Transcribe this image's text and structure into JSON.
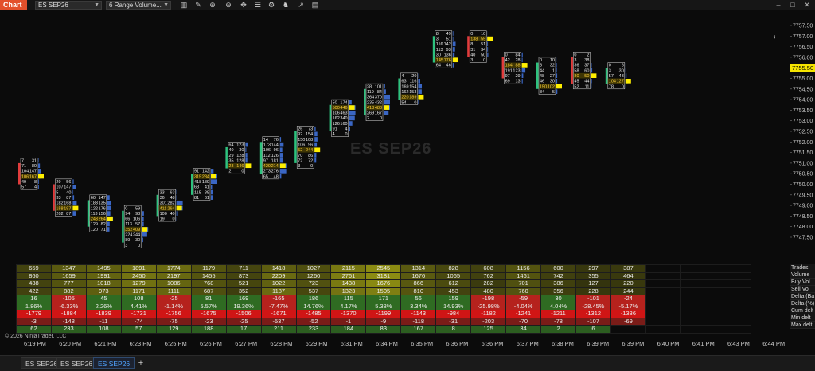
{
  "toolbar": {
    "badge": "Chart",
    "instrument": "ES SEP26",
    "bar_type": "6 Range Volume...",
    "icons": [
      "bar-style-icon",
      "draw-tool-icon",
      "zoom-in-icon",
      "zoom-out-icon",
      "crosshair-icon",
      "hand-icon",
      "properties-icon",
      "strategy-icon",
      "indicator-icon",
      "data-box-icon"
    ]
  },
  "watermark": "ES SEP26",
  "copyright": "© 2026 NinjaTrader, LLC",
  "price_axis": {
    "ticks": [
      "7757.50",
      "7757.00",
      "7756.50",
      "7756.00",
      "7755.50",
      "7755.00",
      "7754.50",
      "7754.00",
      "7753.50",
      "7753.00",
      "7752.50",
      "7752.00",
      "7751.50",
      "7751.00",
      "7750.50",
      "7750.00",
      "7749.50",
      "7749.00",
      "7748.50",
      "7748.00",
      "7747.50"
    ],
    "current_price": "7755.50"
  },
  "chart_data": {
    "type": "footprint",
    "price_min": 7747.5,
    "price_max": 7757.5,
    "bars": [
      {
        "start": 7751.25,
        "rows": [
          [
            "7",
            "31"
          ],
          [
            "71",
            "80"
          ],
          [
            "104",
            "147"
          ],
          [
            "106",
            "167"
          ],
          [
            "49",
            "8"
          ],
          [
            "57",
            "4"
          ]
        ],
        "up": false,
        "poc": 3
      },
      {
        "start": 7750.25,
        "rows": [
          [
            "29",
            "56"
          ],
          [
            "107",
            "147"
          ],
          [
            "5",
            "40"
          ],
          [
            "33",
            "87"
          ],
          [
            "182",
            "168"
          ],
          [
            "158",
            "197"
          ],
          [
            "202",
            "87"
          ]
        ],
        "up": false,
        "poc": 5
      },
      {
        "start": 7749.5,
        "rows": [
          [
            "60",
            "147"
          ],
          [
            "183",
            "135"
          ],
          [
            "122",
            "176"
          ],
          [
            "113",
            "156"
          ],
          [
            "243",
            "264"
          ],
          [
            "129",
            "82"
          ],
          [
            "120",
            "71"
          ]
        ],
        "up": true,
        "poc": 4
      },
      {
        "start": 7749.0,
        "rows": [
          [
            "0",
            "59"
          ],
          [
            "94",
            "93"
          ],
          [
            "66",
            "106"
          ],
          [
            "113",
            "57"
          ],
          [
            "352",
            "409"
          ],
          [
            "224",
            "244"
          ],
          [
            "89",
            "30"
          ],
          [
            "3",
            "0"
          ]
        ],
        "up": true,
        "poc": 4
      },
      {
        "start": 7749.75,
        "rows": [
          [
            "33",
            "63"
          ],
          [
            "36",
            "48"
          ],
          [
            "301",
            "282"
          ],
          [
            "411",
            "264"
          ],
          [
            "100",
            "40"
          ],
          [
            "19",
            "0"
          ]
        ],
        "up": true,
        "poc": 3
      },
      {
        "start": 7750.75,
        "rows": [
          [
            "91",
            "142"
          ],
          [
            "315",
            "284"
          ],
          [
            "418",
            "189"
          ],
          [
            "63",
            "41"
          ],
          [
            "115",
            "88"
          ],
          [
            "81",
            "61"
          ]
        ],
        "up": true,
        "poc": 1
      },
      {
        "start": 7752.0,
        "rows": [
          [
            "64",
            "123"
          ],
          [
            "40",
            "30"
          ],
          [
            "29",
            "128"
          ],
          [
            "35",
            "128"
          ],
          [
            "23",
            "146"
          ],
          [
            "2",
            "0"
          ]
        ],
        "up": true,
        "poc": 4
      },
      {
        "start": 7752.25,
        "rows": [
          [
            "14",
            "76"
          ],
          [
            "173",
            "144"
          ],
          [
            "106",
            "96"
          ],
          [
            "112",
            "126"
          ],
          [
            "97",
            "181"
          ],
          [
            "429",
            "214"
          ],
          [
            "273",
            "276"
          ],
          [
            "65",
            "48"
          ]
        ],
        "up": true,
        "poc": 5
      },
      {
        "start": 7752.75,
        "rows": [
          [
            "26",
            "73"
          ],
          [
            "92",
            "154"
          ],
          [
            "150",
            "108"
          ],
          [
            "106",
            "96"
          ],
          [
            "52",
            "244"
          ],
          [
            "70",
            "86"
          ],
          [
            "72",
            "72"
          ],
          [
            "3",
            "0"
          ]
        ],
        "up": true,
        "poc": 4
      },
      {
        "start": 7754.0,
        "rows": [
          [
            "50",
            "174"
          ],
          [
            "500",
            "446"
          ],
          [
            "106",
            "463"
          ],
          [
            "162",
            "340"
          ],
          [
            "126",
            "160"
          ],
          [
            "91",
            "4"
          ],
          [
            "4",
            "0"
          ]
        ],
        "up": true,
        "poc": 1
      },
      {
        "start": 7754.75,
        "rows": [
          [
            "28",
            "101"
          ],
          [
            "119",
            "84"
          ],
          [
            "364",
            "370"
          ],
          [
            "235",
            "432"
          ],
          [
            "413",
            "488"
          ],
          [
            "269",
            "167"
          ],
          [
            "2",
            "0"
          ]
        ],
        "up": true,
        "poc": 4
      },
      {
        "start": 7755.25,
        "rows": [
          [
            "4",
            "20"
          ],
          [
            "63",
            "116"
          ],
          [
            "169",
            "154"
          ],
          [
            "162",
            "153"
          ],
          [
            "220",
            "189"
          ],
          [
            "54",
            "0"
          ]
        ],
        "up": true,
        "poc": 4
      },
      {
        "start": 7757.25,
        "rows": [
          [
            "8",
            "49"
          ],
          [
            "3",
            "51"
          ],
          [
            "116",
            "142"
          ],
          [
            "113",
            "93"
          ],
          [
            "30",
            "136"
          ],
          [
            "145",
            "176"
          ],
          [
            "64",
            "46"
          ]
        ],
        "up": true,
        "poc": 5
      },
      {
        "start": 7757.25,
        "rows": [
          [
            "0",
            "10"
          ],
          [
            "138",
            "55"
          ],
          [
            "8",
            "51"
          ],
          [
            "31",
            "34"
          ],
          [
            "40",
            "50"
          ],
          [
            "3",
            "0"
          ]
        ],
        "up": false,
        "poc": 1
      },
      {
        "start": 7756.25,
        "rows": [
          [
            "0",
            "84"
          ],
          [
            "42",
            "28"
          ],
          [
            "184",
            "88"
          ],
          [
            "191",
            "123"
          ],
          [
            "97",
            "29"
          ],
          [
            "69",
            "13"
          ]
        ],
        "up": false,
        "poc": 2
      },
      {
        "start": 7756.0,
        "rows": [
          [
            "0",
            "10"
          ],
          [
            "8",
            "32"
          ],
          [
            "44",
            "1"
          ],
          [
            "48",
            "27"
          ],
          [
            "46",
            "30"
          ],
          [
            "150",
            "102"
          ],
          [
            "84",
            "5"
          ]
        ],
        "up": true,
        "poc": 5
      },
      {
        "start": 7756.25,
        "rows": [
          [
            "0",
            "2"
          ],
          [
            "3",
            "38"
          ],
          [
            "36",
            "37"
          ],
          [
            "58",
            "60"
          ],
          [
            "80",
            "50"
          ],
          [
            "45",
            "44"
          ],
          [
            "52",
            "11"
          ]
        ],
        "up": false,
        "poc": 4
      },
      {
        "start": 7755.75,
        "rows": [
          [
            "0",
            "6"
          ],
          [
            "3",
            "30"
          ],
          [
            "57",
            "43"
          ],
          [
            "104",
            "127"
          ],
          [
            "78",
            "0"
          ]
        ],
        "up": true,
        "poc": 3
      }
    ],
    "stats": {
      "rows": [
        {
          "label": "Trades",
          "values": [
            "659",
            "1347",
            "1495",
            "1891",
            "1774",
            "1179",
            "711",
            "1418",
            "1027",
            "2115",
            "2545",
            "1314",
            "828",
            "608",
            "1156",
            "600",
            "297",
            "387"
          ]
        },
        {
          "label": "Volume",
          "values": [
            "860",
            "1659",
            "1991",
            "2450",
            "2197",
            "1455",
            "873",
            "2209",
            "1260",
            "2761",
            "3181",
            "1676",
            "1065",
            "762",
            "1461",
            "742",
            "355",
            "464"
          ]
        },
        {
          "label": "Buy Vol",
          "values": [
            "438",
            "777",
            "1018",
            "1279",
            "1086",
            "768",
            "521",
            "1022",
            "723",
            "1438",
            "1676",
            "866",
            "612",
            "282",
            "701",
            "386",
            "127",
            "220"
          ]
        },
        {
          "label": "Sell Vol",
          "values": [
            "422",
            "882",
            "973",
            "1171",
            "1111",
            "687",
            "352",
            "1187",
            "537",
            "1323",
            "1505",
            "810",
            "453",
            "480",
            "760",
            "356",
            "228",
            "244"
          ]
        },
        {
          "label": "Delta (Ba",
          "values": [
            "16",
            "-105",
            "45",
            "108",
            "-25",
            "81",
            "169",
            "-165",
            "186",
            "115",
            "171",
            "56",
            "159",
            "-198",
            "-59",
            "30",
            "-101",
            "-24"
          ]
        },
        {
          "label": "Delta (%)",
          "values": [
            "1.86%",
            "-6.33%",
            "2.26%",
            "4.41%",
            "-1.14%",
            "5.57%",
            "19.36%",
            "-7.47%",
            "14.76%",
            "4.17%",
            "5.38%",
            "3.34%",
            "14.93%",
            "-25.98%",
            "-4.04%",
            "4.04%",
            "-28.45%",
            "-5.17%"
          ]
        },
        {
          "label": "Cum delt",
          "values": [
            "-1779",
            "-1884",
            "-1839",
            "-1731",
            "-1756",
            "-1675",
            "-1506",
            "-1671",
            "-1485",
            "-1370",
            "-1199",
            "-1143",
            "-984",
            "-1182",
            "-1241",
            "-1211",
            "-1312",
            "-1336"
          ]
        },
        {
          "label": "Min delt",
          "values": [
            "-3",
            "-148",
            "-11",
            "-74",
            "-75",
            "-23",
            "-25",
            "-537",
            "-52",
            "-1",
            "-9",
            "-118",
            "-31",
            "-203",
            "-70",
            "-78",
            "-107",
            "-69"
          ]
        },
        {
          "label": "Max delt",
          "values": [
            "62",
            "233",
            "108",
            "57",
            "129",
            "188",
            "17",
            "211",
            "233",
            "184",
            "83",
            "167",
            "8",
            "125",
            "34",
            "2",
            "6"
          ]
        }
      ]
    },
    "x_ticks": [
      "6:19 PM",
      "6:20 PM",
      "6:21 PM",
      "6:23 PM",
      "6:25 PM",
      "6:26 PM",
      "6:27 PM",
      "6:28 PM",
      "6:29 PM",
      "6:31 PM",
      "6:34 PM",
      "6:35 PM",
      "6:36 PM",
      "6:36 PM",
      "6:37 PM",
      "6:38 PM",
      "6:39 PM",
      "6:39 PM",
      "6:40 PM",
      "6:41 PM",
      "6:43 PM",
      "6:44 PM"
    ]
  },
  "tabs": [
    {
      "label": "ES SEP26",
      "active": false
    },
    {
      "label": "ES SEP26",
      "active": false
    },
    {
      "label": "ES SEP26",
      "active": true
    }
  ],
  "colors": {
    "up_bar": "#2ec27e",
    "down_bar": "#e23c3c",
    "poc": "#ffef00",
    "volume_profile": "#3a66c4",
    "positive": "#3b7a2b",
    "negative": "#c41e1e"
  }
}
